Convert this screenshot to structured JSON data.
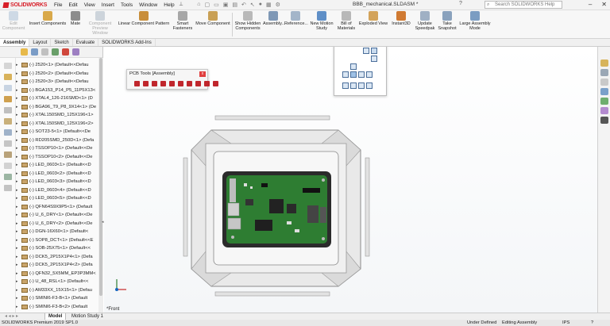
{
  "app": {
    "logo_text": "SOLIDWORKS",
    "document_title": "BBB_mechanical.SLDASM *",
    "search_placeholder": "Search SOLIDWORKS Help",
    "menu": [
      "File",
      "Edit",
      "View",
      "Insert",
      "Tools",
      "Window",
      "Help"
    ]
  },
  "command_manager": {
    "items": [
      {
        "label": "Edit Component",
        "disabled": true
      },
      {
        "label": "Insert Components",
        "disabled": false
      },
      {
        "label": "Mate",
        "disabled": false
      },
      {
        "label": "Component Preview Window",
        "disabled": true
      },
      {
        "label": "Linear Component Pattern",
        "disabled": false
      },
      {
        "label": "Smart Fasteners",
        "disabled": false
      },
      {
        "label": "Move Component",
        "disabled": false
      },
      {
        "label": "Show Hidden Components",
        "disabled": false
      },
      {
        "label": "Assembly...",
        "disabled": false
      },
      {
        "label": "Reference...",
        "disabled": false
      },
      {
        "label": "New Motion Study",
        "disabled": false
      },
      {
        "label": "Bill of Materials",
        "disabled": false
      },
      {
        "label": "Exploded View",
        "disabled": false
      },
      {
        "label": "Instant3D",
        "disabled": false
      },
      {
        "label": "Update Speedpak",
        "disabled": false
      },
      {
        "label": "Take Snapshot",
        "disabled": false
      },
      {
        "label": "Large Assembly Mode",
        "disabled": false
      }
    ]
  },
  "tabs": [
    "Assembly",
    "Layout",
    "Sketch",
    "Evaluate",
    "SOLIDWORKS Add-Ins"
  ],
  "feature_tree": {
    "items": [
      "(-) 2520<1> (Default<<Defau",
      "(-) 2520<2> (Default<<Defau",
      "(-) 2520<3> (Default<<Defau",
      "(-) BGA153_P14_P5_11P5X13<",
      "(-) XTAL4_126-216SMD<1> (D",
      "(-) BGA96_T9_P8_9X14<1> (De",
      "(-) XTAL150SMD_125X196<1>",
      "(-) XTAL150SMD_125X196<2>",
      "(-) SOT23-5<1> (Default<<De",
      "(-) RD205SMD_250D<1> (Defa",
      "(-) TSSOP10<1> (Default<<De",
      "(-) TSSOP10<2> (Default<<De",
      "(-) LED_0603<1> (Default<<D",
      "(-) LED_0603<2> (Default<<D",
      "(-) LED_0603<3> (Default<<D",
      "(-) LED_0603<4> (Default<<D",
      "(-) LED_0603<5> (Default<<D",
      "(-) QFN64S9X9P5<1> (Default",
      "(-) U_6_DRY<1> (Default<<De",
      "(-) U_6_DRY<2> (Default<<De",
      "(-) DGN-16X60<1> (Default<",
      "(-) SOP8_DCT<1> (Default<<E",
      "(-) SOB-25X75<1> (Default<<",
      "(-) DCK5_2P15X1P4<1> (Defa",
      "(-) DCK5_2P15X1P4<2> (Defa",
      "(-) QFN32_5X5MM_EP3P3MM<",
      "(-) U_48_RSL<1> (Default<<",
      "(-) AM33XX_15X15<1> (Defau",
      "(-) SMINI6-F3-B<1> (Default",
      "(-) SMINI6-F3-B<2> (Default"
    ]
  },
  "pcb_tools": {
    "title": "PCB Tools [Assembly]",
    "close": "x"
  },
  "graphics": {
    "view_label": "*Front"
  },
  "bottom_tabs": [
    "Model",
    "Motion Study 1"
  ],
  "status": {
    "product": "SOLIDWORKS Premium 2019 SP1.0",
    "definition": "Under Defined",
    "mode": "Editing Assembly",
    "units": "IPS"
  },
  "colors": {
    "brand": "#d71e28",
    "pcb": "#2e7d32",
    "tray": "#d9d9d9"
  }
}
